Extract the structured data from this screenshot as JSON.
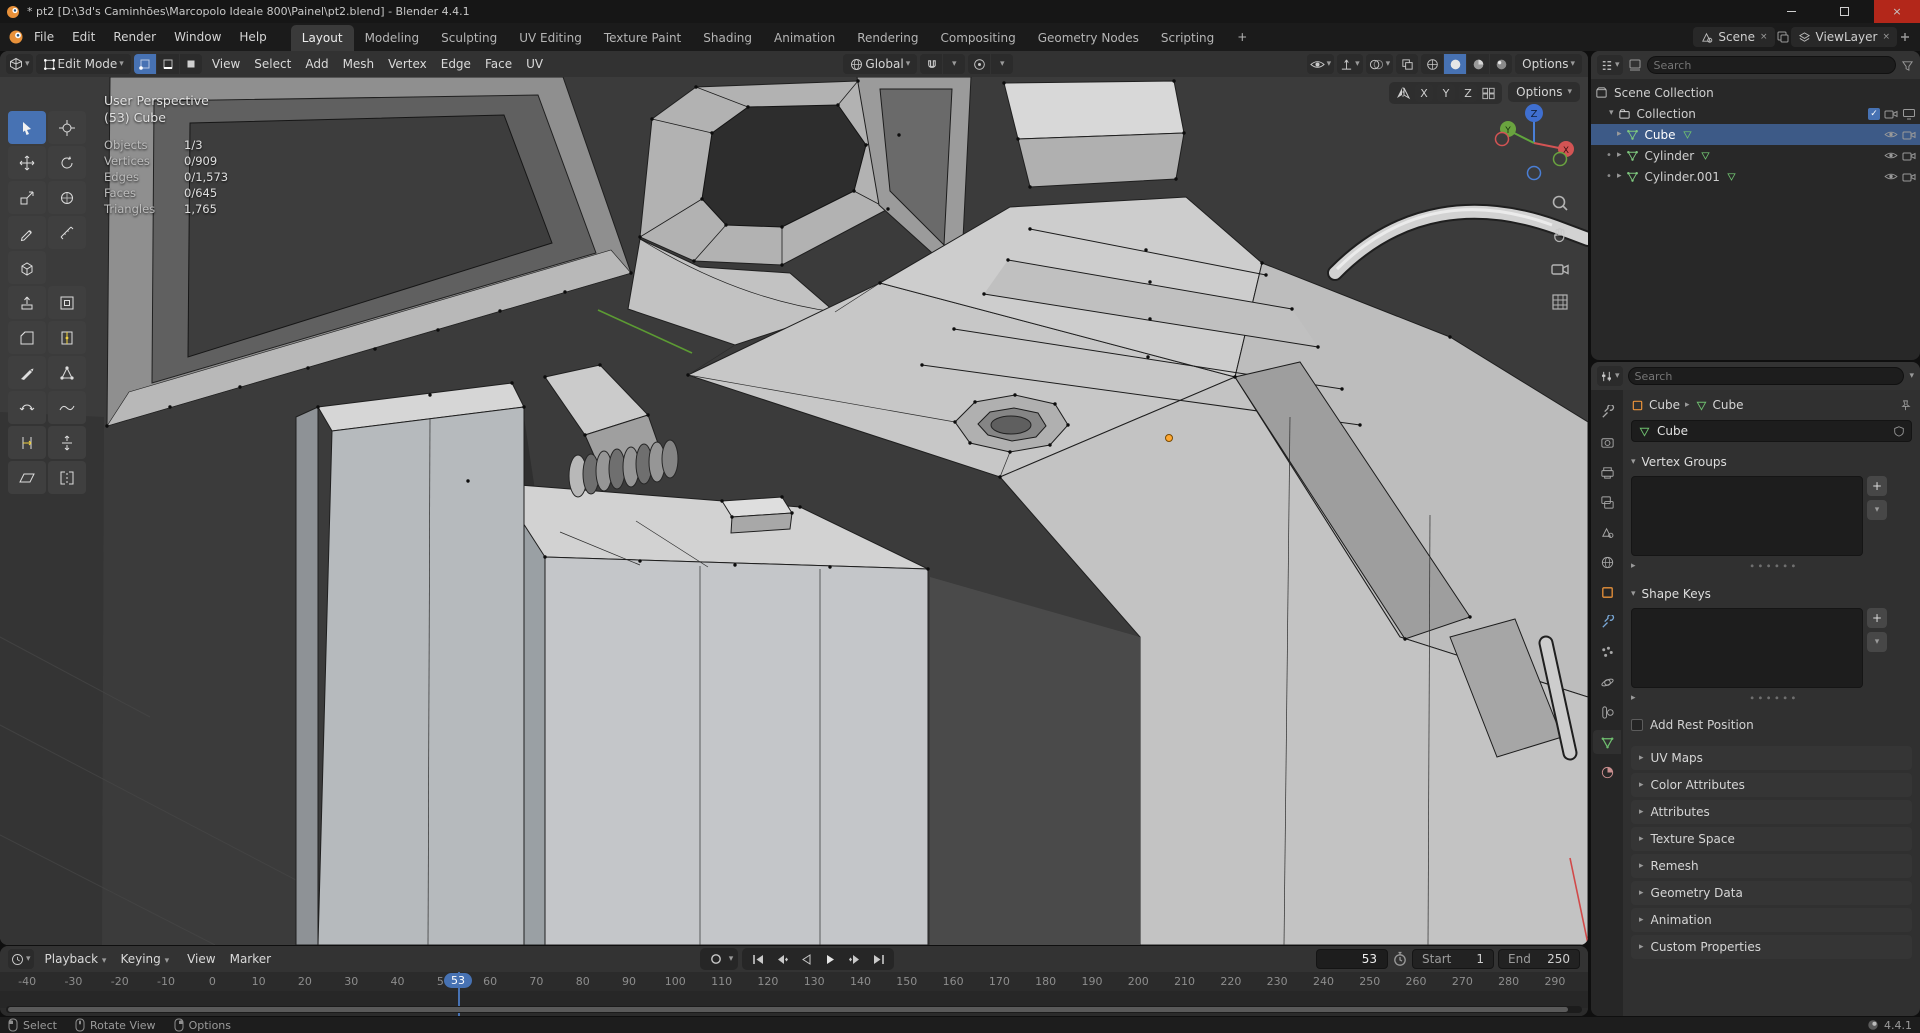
{
  "window": {
    "title": "* pt2 [D:\\3d's Caminhões\\Marcopolo Ideale 800\\Painel\\pt2.blend] - Blender 4.4.1"
  },
  "icons": {
    "chevron_down": "▾",
    "chevron_right": "▸",
    "dot": "•",
    "close": "×",
    "plus": "+",
    "check": "✓",
    "grip": "∙∙∙∙∙∙"
  },
  "topbar": {
    "menus": [
      "File",
      "Edit",
      "Render",
      "Window",
      "Help"
    ],
    "workspaces": [
      {
        "label": "Layout",
        "active": true
      },
      {
        "label": "Modeling"
      },
      {
        "label": "Sculpting"
      },
      {
        "label": "UV Editing"
      },
      {
        "label": "Texture Paint"
      },
      {
        "label": "Shading"
      },
      {
        "label": "Animation"
      },
      {
        "label": "Rendering"
      },
      {
        "label": "Compositing"
      },
      {
        "label": "Geometry Nodes"
      },
      {
        "label": "Scripting"
      }
    ],
    "add_workspace": "+",
    "scene_name": "Scene",
    "view_layer_name": "ViewLayer"
  },
  "viewport": {
    "header": {
      "mode": "Edit Mode",
      "menus": [
        "View",
        "Select",
        "Add",
        "Mesh",
        "Vertex",
        "Edge",
        "Face",
        "UV"
      ],
      "orientation": "Global",
      "options_label": "Options"
    },
    "mirror": {
      "x": "X",
      "y": "Y",
      "z": "Z"
    },
    "overlay": {
      "perspective": "User Perspective",
      "frame_object": "(53) Cube",
      "stats": [
        {
          "label": "Objects",
          "value": "1/3"
        },
        {
          "label": "Vertices",
          "value": "0/909"
        },
        {
          "label": "Edges",
          "value": "0/1,573"
        },
        {
          "label": "Faces",
          "value": "0/645"
        },
        {
          "label": "Triangles",
          "value": "1,765"
        }
      ]
    },
    "gizmo": {
      "x": "X",
      "y": "Y",
      "z": "Z"
    }
  },
  "toolbar": {
    "tools": [
      "Tweak",
      "Cursor",
      "Move",
      "Rotate",
      "Scale",
      "Transform",
      "Annotate",
      "Measure",
      "Add Cube",
      "Extrude Region",
      "Inset Faces",
      "Bevel",
      "Loop Cut",
      "Knife",
      "Poly Build",
      "Spin",
      "Smooth",
      "Edge Slide",
      "Shrink/Fatten",
      "Shear",
      "Rip Region"
    ]
  },
  "outliner": {
    "search_placeholder": "Search",
    "root": "Scene Collection",
    "collection": "Collection",
    "objects": [
      {
        "name": "Cube",
        "selected": true
      },
      {
        "name": "Cylinder"
      },
      {
        "name": "Cylinder.001"
      }
    ]
  },
  "properties": {
    "search_placeholder": "Search",
    "breadcrumb_object": "Cube",
    "breadcrumb_data": "Cube",
    "name_value": "Cube",
    "vertex_groups_label": "Vertex Groups",
    "shape_keys_label": "Shape Keys",
    "add_rest_position": "Add Rest Position",
    "panels_collapsed": [
      "UV Maps",
      "Color Attributes",
      "Attributes",
      "Texture Space",
      "Remesh",
      "Geometry Data",
      "Animation",
      "Custom Properties"
    ]
  },
  "timeline": {
    "menus_dropdown": [
      "Playback",
      "Keying"
    ],
    "menus_plain": [
      "View",
      "Marker"
    ],
    "current_frame": "53",
    "start_label": "Start",
    "start_value": "1",
    "end_label": "End",
    "end_value": "250",
    "ticks": [
      "-40",
      "-30",
      "-20",
      "-10",
      "0",
      "10",
      "20",
      "30",
      "40",
      "50",
      "60",
      "70",
      "80",
      "90",
      "100",
      "110",
      "120",
      "130",
      "140",
      "150",
      "160",
      "170",
      "180",
      "190",
      "200",
      "210",
      "220",
      "230",
      "240",
      "250",
      "260",
      "270",
      "280",
      "290"
    ]
  },
  "statusbar": {
    "select_label": "Select",
    "rotate_label": "Rotate View",
    "options_label": "Options",
    "version": "4.4.1"
  }
}
